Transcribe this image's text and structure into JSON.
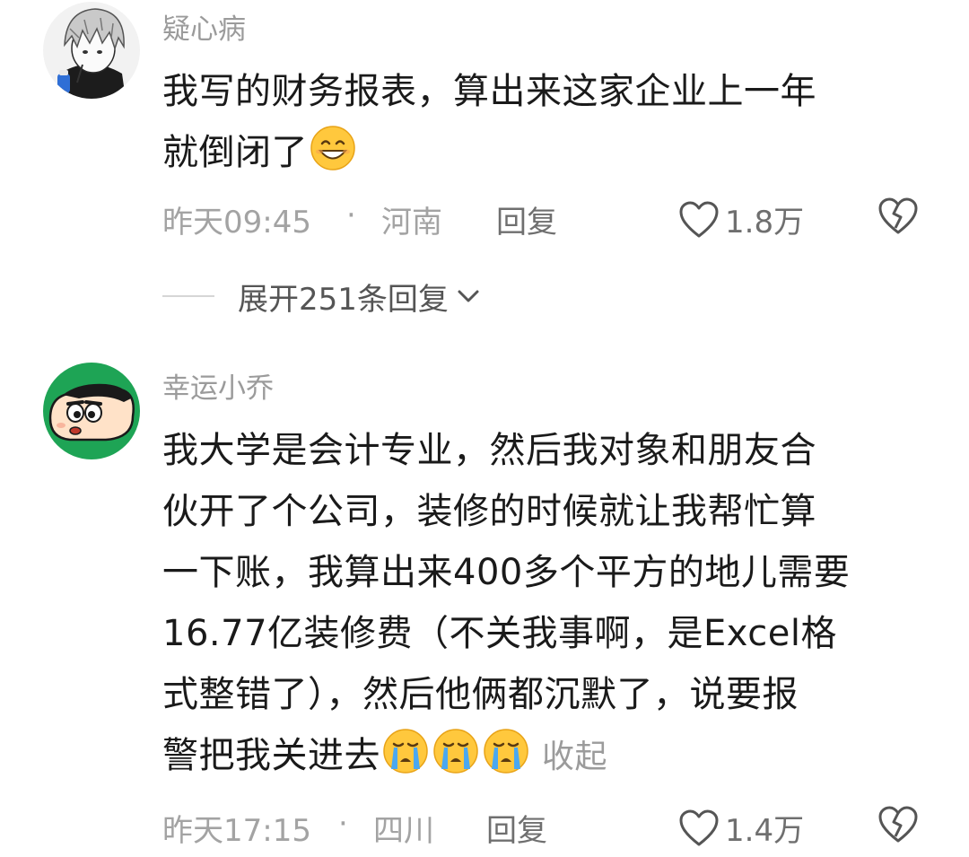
{
  "comments": [
    {
      "username": "疑心病",
      "lines": [
        "我写的财务报表，算出来这家企业上一年",
        "就倒闭了"
      ],
      "time": "昨天09:45",
      "separator": "·",
      "location": "河南",
      "reply_label": "回复",
      "likes": "1.8万",
      "avatar_icon": "anime-boy-avatar-icon"
    },
    {
      "username": "幸运小乔",
      "lines": [
        "我大学是会计专业，然后我对象和朋友合",
        "伙开了个公司，装修的时候就让我帮忙算",
        "一下账，我算出来400多个平方的地儿需要",
        "16.77亿装修费（不关我事啊，是Excel格",
        "式整错了），然后他俩都沉默了，说要报",
        "警把我关进去"
      ],
      "collapse_label": "收起",
      "time": "昨天17:15",
      "separator": "·",
      "location": "四川",
      "reply_label": "回复",
      "likes": "1.4万",
      "avatar_icon": "crayon-shinchan-avatar-icon"
    }
  ],
  "expand_replies": {
    "label": "展开251条回复"
  },
  "colors": {
    "meta_gray": "#a3a3a3",
    "username_gray": "#9b9b9b",
    "avatar_green": "#1ea455",
    "emoji_yellow": "#ffc83d"
  }
}
